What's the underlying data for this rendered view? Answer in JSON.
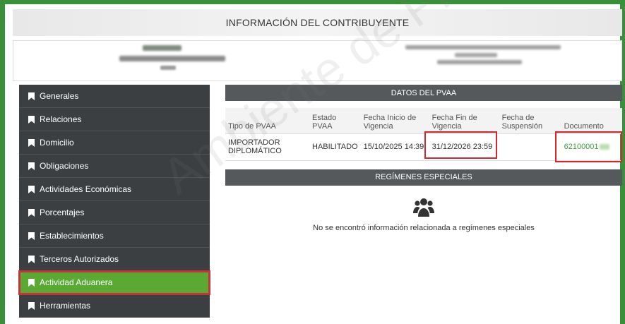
{
  "title": "INFORMACIÓN DEL CONTRIBUYENTE",
  "sidebar": {
    "items": [
      {
        "label": "Generales",
        "icon": "bookmark-icon"
      },
      {
        "label": "Relaciones",
        "icon": "bookmark-icon"
      },
      {
        "label": "Domicilio",
        "icon": "bookmark-icon"
      },
      {
        "label": "Obligaciones",
        "icon": "bookmark-icon"
      },
      {
        "label": "Actividades Económicas",
        "icon": "bookmark-icon"
      },
      {
        "label": "Porcentajes",
        "icon": "bookmark-icon"
      },
      {
        "label": "Establecimientos",
        "icon": "bookmark-icon"
      },
      {
        "label": "Terceros Autorizados",
        "icon": "bookmark-icon"
      },
      {
        "label": "Actividad Aduanera",
        "icon": "bookmark-icon",
        "active": true
      },
      {
        "label": "Herramientas",
        "icon": "bookmark-icon"
      }
    ]
  },
  "pvaa": {
    "section_title": "DATOS DEL PVAA",
    "columns": [
      "Tipo de PVAA",
      "Estado PVAA",
      "Fecha Inicio de Vigencia",
      "Fecha Fin de Vigencia",
      "Fecha de Suspensión",
      "Documento"
    ],
    "row": {
      "tipo": "IMPORTADOR DIPLOMÁTICO",
      "estado": "HABILITADO",
      "inicio": "15/10/2025 14:39",
      "fin": "31/12/2026 23:59",
      "suspension": "",
      "documento": "62100001"
    }
  },
  "regimenes": {
    "section_title": "REGÍMENES ESPECIALES",
    "empty_icon": "users-icon",
    "empty_message": "No se encontró información relacionada a regímenes especiales"
  },
  "watermark": "Ambiente de Pruebas",
  "colors": {
    "frame": "#3a8f3a",
    "sidebar_bg": "#3b3f42",
    "active_item": "#5aa933",
    "highlight": "#d0282e",
    "section_bar": "#55595c",
    "link": "#3aa13a"
  }
}
